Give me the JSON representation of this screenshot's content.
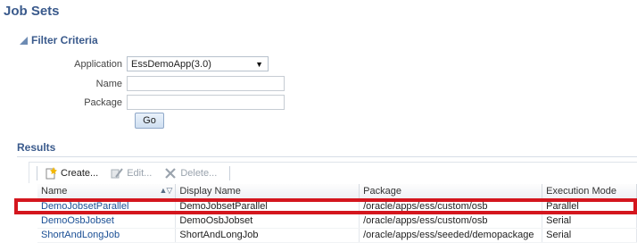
{
  "page": {
    "title": "Job Sets"
  },
  "filter": {
    "header": "Filter Criteria",
    "application_label": "Application",
    "application_value": "EssDemoApp(3.0)",
    "name_label": "Name",
    "name_value": "",
    "package_label": "Package",
    "package_value": "",
    "go_label": "Go"
  },
  "results": {
    "title": "Results",
    "toolbar": {
      "create": "Create...",
      "edit": "Edit...",
      "delete": "Delete..."
    },
    "columns": [
      "Name",
      "Display Name",
      "Package",
      "Execution Mode"
    ],
    "rows": [
      {
        "name": "DemoJobsetParallel",
        "display_name": "DemoJobsetParallel",
        "package": "/oracle/apps/ess/custom/osb",
        "mode": "Parallel"
      },
      {
        "name": "DemoOsbJobset",
        "display_name": "DemoOsbJobset",
        "package": "/oracle/apps/ess/custom/osb",
        "mode": "Serial"
      },
      {
        "name": "ShortAndLongJob",
        "display_name": "ShortAndLongJob",
        "package": "/oracle/apps/ess/seeded/demopackage",
        "mode": "Serial"
      }
    ]
  },
  "colors": {
    "heading": "#3a5a8c",
    "link": "#1a4f95",
    "highlight": "#d4161e"
  }
}
